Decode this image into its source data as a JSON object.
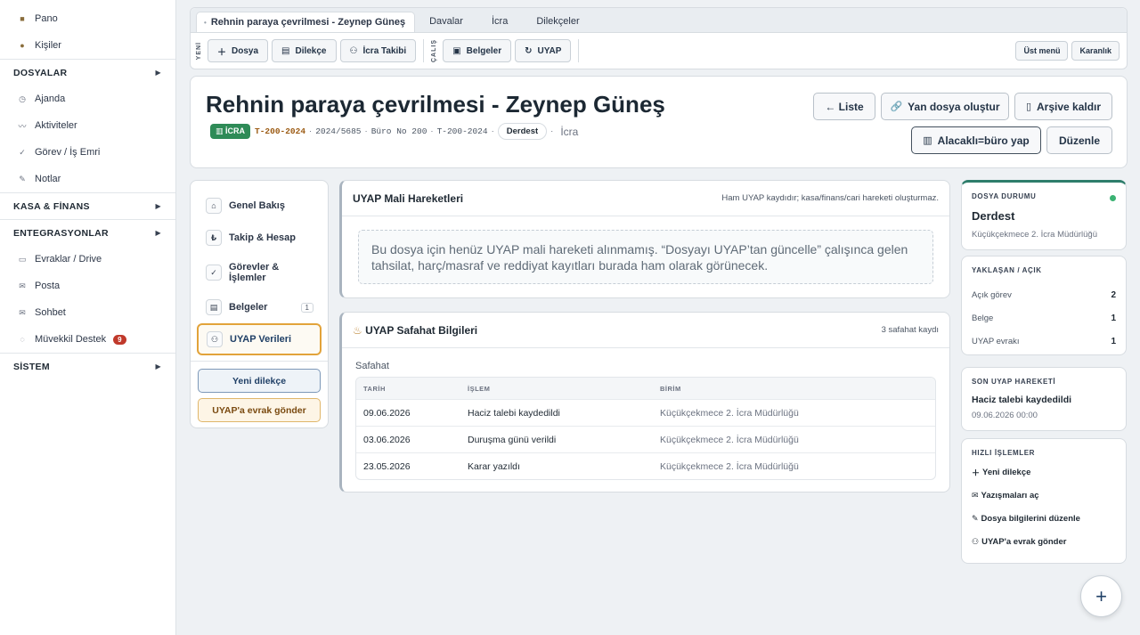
{
  "sidebar": {
    "top_items": [
      {
        "label": "Pano",
        "icon": "grid-icon"
      },
      {
        "label": "Kişiler",
        "icon": "people-icon"
      }
    ],
    "sections": {
      "dosyalar": "DOSYALAR",
      "kasa": "KASA & FİNANS",
      "entegrasyonlar": "ENTEGRASYONLAR",
      "sistem": "SİSTEM"
    },
    "dosyalar_items": [
      "Ajanda",
      "Aktiviteler",
      "Görev / İş Emri",
      "Notlar"
    ],
    "entegrasyon_items": [
      "Evraklar / Drive",
      "Posta",
      "Sohbet",
      "Müvekkil Destek"
    ],
    "destek_badge": "9"
  },
  "tabs": {
    "active": "Rehnin paraya çevrilmesi - Zeynep Güneş",
    "others": [
      "Davalar",
      "İcra",
      "Dilekçeler"
    ]
  },
  "toolbar": {
    "yeni_label": "YENİ",
    "calis_label": "ÇALIŞ",
    "dosya": "Dosya",
    "dilekce": "Dilekçe",
    "icra_takibi": "İcra Takibi",
    "belgeler": "Belgeler",
    "uyap": "UYAP",
    "ust_menu": "Üst menü",
    "karanlik": "Karanlık"
  },
  "header": {
    "title": "Rehnin paraya çevrilmesi - Zeynep Güneş",
    "badge": "İCRA",
    "code": "T-200-2024",
    "esas": "2024/5685",
    "buro": "Büro No 200",
    "code2": "T-200-2024",
    "status": "Derdest",
    "type": "İcra",
    "btn_liste": "← Liste",
    "btn_yan": "Yan dosya oluştur",
    "btn_arsiv": "Arşive kaldır",
    "btn_alacakli": "Alacaklı=büro yap",
    "btn_duzenle": "Düzenle"
  },
  "leftnav": {
    "items": [
      "Genel Bakış",
      "Takip & Hesap",
      "Görevler & İşlemler",
      "Belgeler",
      "UYAP Verileri"
    ],
    "belgeler_count": "1",
    "btn_dilekce": "Yeni dilekçe",
    "btn_uyap": "UYAP'a evrak gönder"
  },
  "mali": {
    "title": "UYAP Mali Hareketleri",
    "note": "Ham UYAP kaydıdır; kasa/finans/cari hareketi oluşturmaz.",
    "empty": "Bu dosya için henüz UYAP mali hareketi alınmamış. “Dosyayı UYAP’tan güncelle” çalışınca gelen tahsilat, harç/masraf ve reddiyat kayıtları burada ham olarak görünecek."
  },
  "safahat": {
    "title": "UYAP Safahat Bilgileri",
    "count": "3 safahat kaydı",
    "label": "Safahat",
    "headers": [
      "TARİH",
      "İŞLEM",
      "BİRİM"
    ],
    "rows": [
      [
        "09.06.2026",
        "Haciz talebi kaydedildi",
        "Küçükçekmece 2. İcra Müdürlüğü"
      ],
      [
        "03.06.2026",
        "Duruşma günü verildi",
        "Küçükçekmece 2. İcra Müdürlüğü"
      ],
      [
        "23.05.2026",
        "Karar yazıldı",
        "Küçükçekmece 2. İcra Müdürlüğü"
      ]
    ]
  },
  "right": {
    "durum_label": "DOSYA DURUMU",
    "durum": "Derdest",
    "durum_sub": "Küçükçekmece 2. İcra Müdürlüğü",
    "yaklasan_label": "YAKLAŞAN / AÇIK",
    "acik_gorev": "Açık görev",
    "acik_gorev_val": "2",
    "belge": "Belge",
    "belge_val": "1",
    "uyap_evraki": "UYAP evrakı",
    "uyap_evraki_val": "1",
    "son_label": "SON UYAP HAREKETİ",
    "son_title": "Haciz talebi kaydedildi",
    "son_date": "09.06.2026 00:00",
    "hizli_label": "HIZLI İŞLEMLER",
    "hizli": [
      "Yeni dilekçe",
      "Yazışmaları aç",
      "Dosya bilgilerini düzenle",
      "UYAP'a evrak gönder"
    ]
  },
  "fab": "+"
}
